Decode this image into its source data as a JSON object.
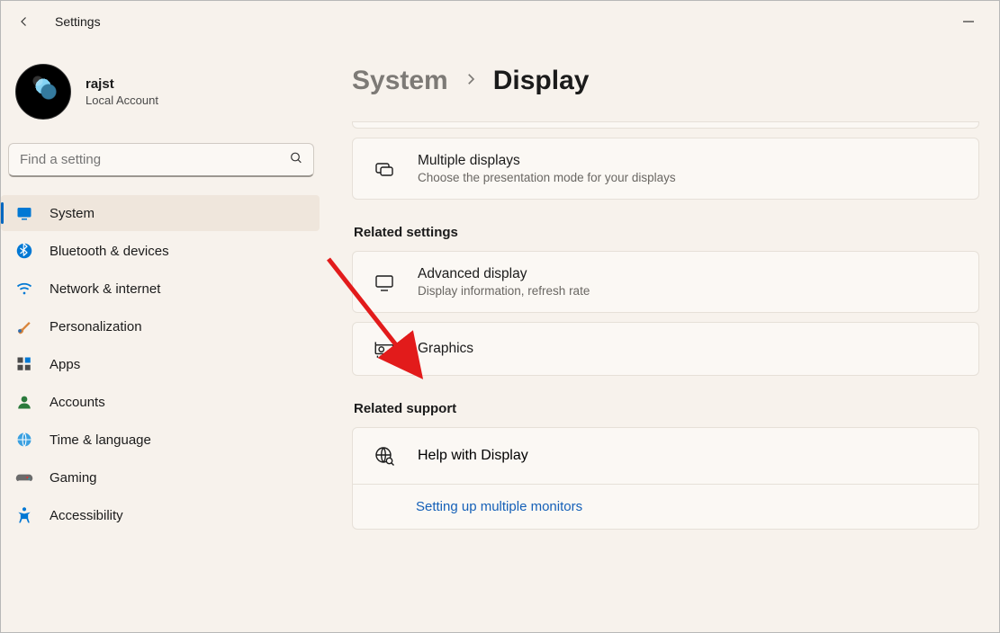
{
  "titlebar": {
    "label": "Settings"
  },
  "user": {
    "name": "rajst",
    "type": "Local Account"
  },
  "search": {
    "placeholder": "Find a setting"
  },
  "nav": {
    "items": [
      {
        "label": "System",
        "icon": "system"
      },
      {
        "label": "Bluetooth & devices",
        "icon": "bluetooth"
      },
      {
        "label": "Network & internet",
        "icon": "wifi"
      },
      {
        "label": "Personalization",
        "icon": "brush"
      },
      {
        "label": "Apps",
        "icon": "apps"
      },
      {
        "label": "Accounts",
        "icon": "person"
      },
      {
        "label": "Time & language",
        "icon": "time"
      },
      {
        "label": "Gaming",
        "icon": "gaming"
      },
      {
        "label": "Accessibility",
        "icon": "accessibility"
      }
    ],
    "selected": 0
  },
  "breadcrumb": {
    "parent": "System",
    "current": "Display"
  },
  "cards": {
    "multiple_displays": {
      "title": "Multiple displays",
      "subtitle": "Choose the presentation mode for your displays"
    }
  },
  "related_settings": {
    "heading": "Related settings",
    "advanced": {
      "title": "Advanced display",
      "subtitle": "Display information, refresh rate"
    },
    "graphics": {
      "title": "Graphics"
    }
  },
  "related_support": {
    "heading": "Related support",
    "help": {
      "title": "Help with Display"
    },
    "link": "Setting up multiple monitors"
  }
}
